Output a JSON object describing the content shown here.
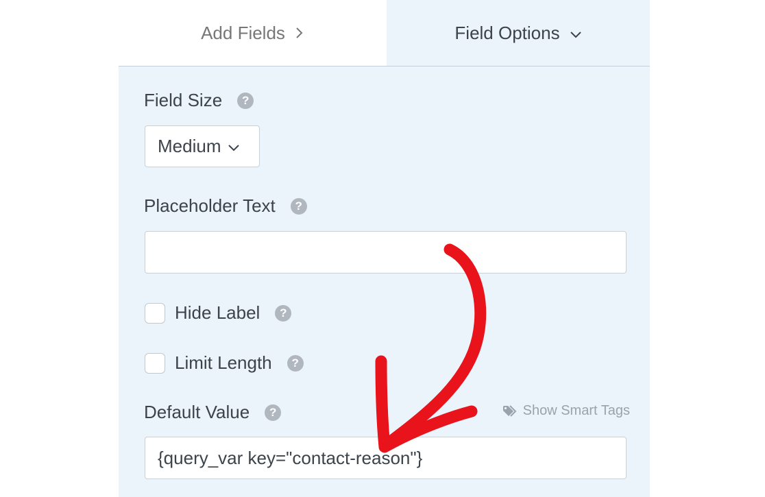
{
  "tabs": {
    "add_fields": "Add Fields",
    "field_options": "Field Options"
  },
  "field_size": {
    "label": "Field Size",
    "value": "Medium"
  },
  "placeholder_text": {
    "label": "Placeholder Text",
    "value": ""
  },
  "hide_label": {
    "label": "Hide Label",
    "checked": false
  },
  "limit_length": {
    "label": "Limit Length",
    "checked": false
  },
  "default_value": {
    "label": "Default Value",
    "value": "{query_var key=\"contact-reason\"}",
    "smart_tags_label": "Show Smart Tags"
  },
  "icons": {
    "help": "question-circle-icon",
    "tag": "tag-icon",
    "chevron_right": "chevron-right-icon",
    "chevron_down": "chevron-down-icon"
  },
  "colors": {
    "panel_bg": "#ebf3fb",
    "text": "#3c434a",
    "annotation_arrow": "#e8131b"
  }
}
